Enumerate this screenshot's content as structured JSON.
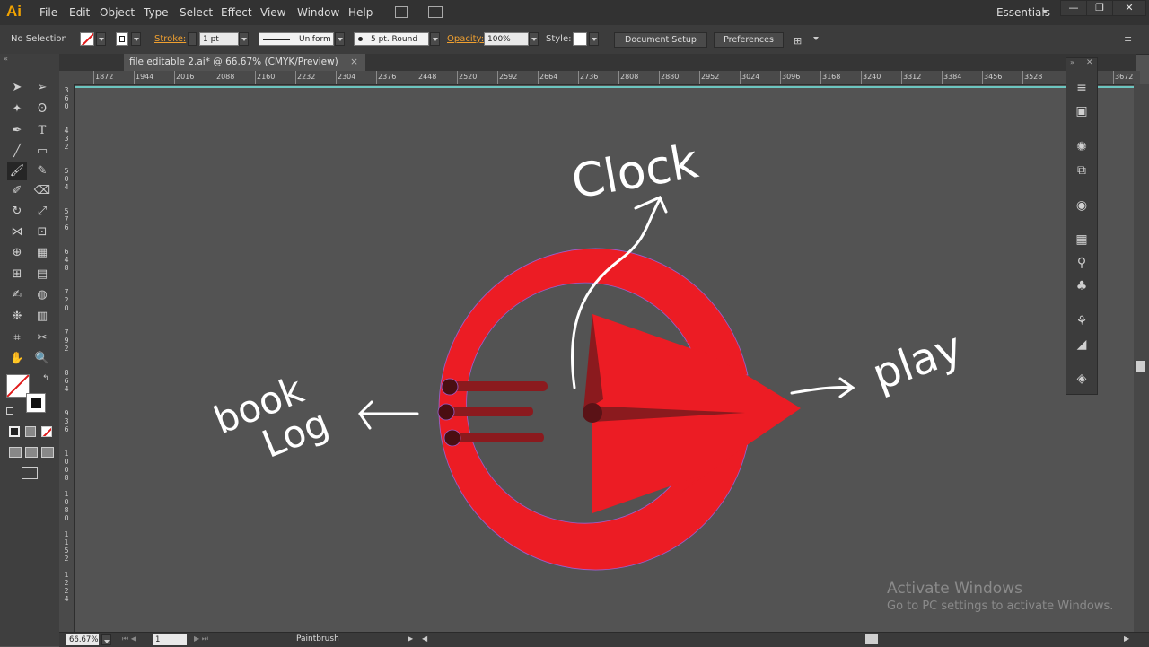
{
  "app": {
    "logo": "Ai"
  },
  "menu": [
    "File",
    "Edit",
    "Object",
    "Type",
    "Select",
    "Effect",
    "View",
    "Window",
    "Help"
  ],
  "workspace": "Essentials",
  "window_buttons": [
    "—",
    "❐",
    "✕"
  ],
  "control_bar": {
    "selection": "No Selection",
    "stroke_label": "Stroke:",
    "stroke_value": "1 pt",
    "profile": "Uniform",
    "brush": "5 pt. Round",
    "opacity_label": "Opacity:",
    "opacity_value": "100%",
    "style_label": "Style:",
    "document_setup": "Document Setup",
    "preferences": "Preferences"
  },
  "document": {
    "tab_title": "file editable 2.ai* @ 66.67% (CMYK/Preview)",
    "close": "×"
  },
  "ruler": {
    "h_ticks": [
      "1872",
      "1944",
      "2016",
      "2088",
      "2160",
      "2232",
      "2304",
      "2376",
      "2448",
      "2520",
      "2592",
      "2664",
      "2736",
      "2808",
      "2880",
      "2952",
      "3024",
      "3096",
      "3168",
      "3240",
      "3312",
      "3384",
      "3456",
      "3528",
      "3672"
    ],
    "v_ticks": [
      "3\n6\n0",
      "4\n3\n2",
      "5\n0\n4",
      "5\n7\n6",
      "6\n4\n8",
      "7\n2\n0",
      "7\n9\n2",
      "8\n6\n4",
      "9\n3\n6",
      "1\n0\n0\n8",
      "1\n0\n8\n0",
      "1\n1\n5\n2",
      "1\n2\n2\n4"
    ]
  },
  "canvas_labels": {
    "clock": "Clock",
    "play": "play",
    "book": "book",
    "log": "Log"
  },
  "status": {
    "zoom": "66.67%",
    "page": "1",
    "tool": "Paintbrush"
  },
  "activation": {
    "title": "Activate Windows",
    "subtitle": "Go to PC settings to activate Windows."
  },
  "colors": {
    "logo_red": "#ec1c24",
    "dark_red": "#8b1a1e",
    "canvas_bg": "#535353",
    "accent_orange": "#f2a300"
  }
}
